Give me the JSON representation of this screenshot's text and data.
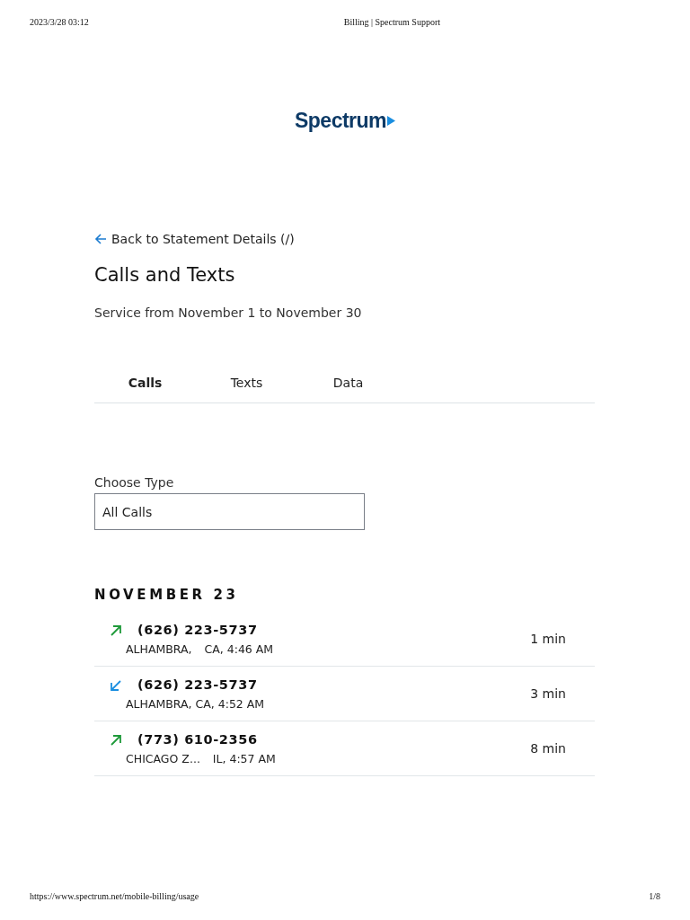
{
  "print_header": {
    "date": "2023/3/28 03:12",
    "title": "Billing | Spectrum Support"
  },
  "logo": {
    "text": "Spectrum"
  },
  "back_link": {
    "label": "Back to Statement Details (/)"
  },
  "title": "Calls and Texts",
  "subtitle": "Service from November 1 to November 30",
  "tabs": [
    {
      "label": "Calls",
      "selected": true
    },
    {
      "label": "Texts",
      "selected": false
    },
    {
      "label": "Data",
      "selected": false
    }
  ],
  "type_select": {
    "label": "Choose Type",
    "value": "All Calls"
  },
  "day": {
    "heading": "NOVEMBER 23",
    "calls": [
      {
        "kind": "outgoing",
        "number": "(626) 223-5737",
        "location": [
          "ALHAMBRA,",
          "CA, 4:46 AM"
        ],
        "duration": "1 min"
      },
      {
        "kind": "incoming",
        "number": "(626) 223-5737",
        "location": [
          "ALHAMBRA, CA, 4:52 AM"
        ],
        "duration": "3 min"
      },
      {
        "kind": "outgoing",
        "number": "(773) 610-2356",
        "location": [
          "CHICAGO Z...",
          "IL, 4:57 AM"
        ],
        "duration": "8 min"
      }
    ]
  },
  "print_footer": {
    "url": "https://www.spectrum.net/mobile-billing/usage",
    "page": "1/8"
  }
}
